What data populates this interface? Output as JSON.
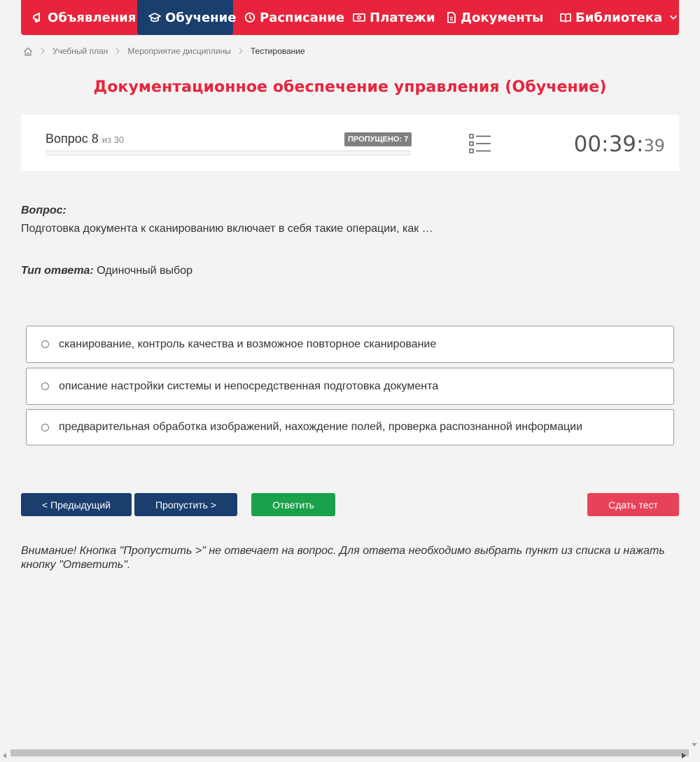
{
  "nav": {
    "items": [
      {
        "label": "Объявления",
        "icon": "megaphone-icon",
        "active": false
      },
      {
        "label": "Обучение",
        "icon": "graduation-cap-icon",
        "active": true
      },
      {
        "label": "Расписание",
        "icon": "clock-icon",
        "active": false
      },
      {
        "label": "Платежи",
        "icon": "money-icon",
        "active": false
      },
      {
        "label": "Документы",
        "icon": "document-icon",
        "active": false
      },
      {
        "label": "Библиотека",
        "icon": "book-icon",
        "active": false,
        "dropdown": true
      }
    ],
    "colors": {
      "bar": "#e8243c",
      "active": "#1a3e6e"
    }
  },
  "breadcrumb": {
    "items": [
      "Учебный план",
      "Мероприятие дисциплины"
    ],
    "current": "Тестирование"
  },
  "page_title": "Документационное обеспечение управления (Обучение)",
  "test_panel": {
    "question_label": "Вопрос 8",
    "question_of": "из 30",
    "skipped_badge": "ПРОПУЩЕНО: 7",
    "progress_fraction": 0.0,
    "timer_main": "00:39:",
    "timer_seconds": "39"
  },
  "question": {
    "heading": "Вопрос:",
    "text": "Подготовка документа к сканированию включает в себя такие операции, как …",
    "answer_type_label": "Тип ответа:",
    "answer_type_value": "Одиночный выбор"
  },
  "answers": [
    "сканирование, контроль качества и возможное повторное сканирование",
    "описание настройки системы и непосредственная подготовка документа",
    "предварительная обработка изображений, нахождение полей, проверка распознанной информации"
  ],
  "buttons": {
    "prev": "< Предыдущий",
    "skip": "Пропустить >",
    "answer": "Ответить",
    "submit": "Сдать тест"
  },
  "notice": "Внимание! Кнопка \"Пропустить >\" не отвечает на вопрос. Для ответа необходимо выбрать пункт из списка и нажать кнопку \"Ответить\"."
}
